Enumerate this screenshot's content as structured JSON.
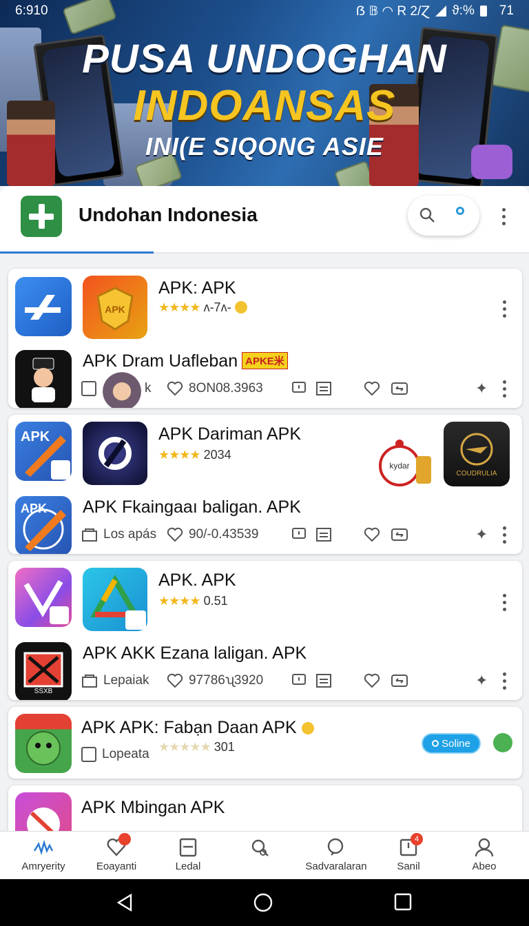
{
  "status": {
    "time": "6:910",
    "indicators": "ẞ 𝔹 ◠ R 2/Ɀ",
    "battery": "ϑ:%",
    "level": "71"
  },
  "banner": {
    "line1": "PUSA UNDOGHAN",
    "line2": "INDOANSAS",
    "line3": "INI(E SIQONG ASIE"
  },
  "header": {
    "title": "Undohan Indonesia",
    "progress": 0.29
  },
  "cards": [
    {
      "top_title": "APK: APK",
      "top_rating": "ʌ-7ʌ-",
      "bottom_title": "APK Dram Uafleban",
      "badge": "APKE米",
      "meta": "k",
      "count": "8ОN08.3963"
    },
    {
      "top_title": "APK Dariman  APK",
      "top_rating": "2034",
      "bottom_title": "APK Fkaingaaı baligan. APK",
      "meta": "Los apás",
      "count": "90/-0.43539",
      "side_label_1": "kydar",
      "side_label_2": "COUDRULIA"
    },
    {
      "top_title": "APK. APK",
      "top_rating": "0.51",
      "bottom_title": "APK AKK Ezana laligan. APK",
      "meta": "Lepaiak",
      "count": "97786ʯ3920",
      "icon_label": "SSXB"
    },
    {
      "title": "APK APK: Fabạn Daan APK",
      "meta": "Lopeata",
      "rating": "301",
      "chip": "Soline"
    },
    {
      "title": "APK Mbingan APK"
    }
  ],
  "nav": [
    {
      "label": "Amryerity",
      "icon": "activity-icon"
    },
    {
      "label": "Eoayanti",
      "icon": "heart-icon"
    },
    {
      "label": "Ledal",
      "icon": "document-icon"
    },
    {
      "label": "",
      "icon": "search-tag-icon"
    },
    {
      "label": "Sadvaralaran",
      "icon": "search-icon"
    },
    {
      "label": "Sanil",
      "icon": "inbox-icon",
      "badge": "4"
    },
    {
      "label": "Abeo",
      "icon": "profile-icon"
    }
  ],
  "colors": {
    "accent": "#2b7ad3",
    "brand_green": "#2f8f45",
    "star": "#f1b71d",
    "chip": "#1ea1e6"
  }
}
